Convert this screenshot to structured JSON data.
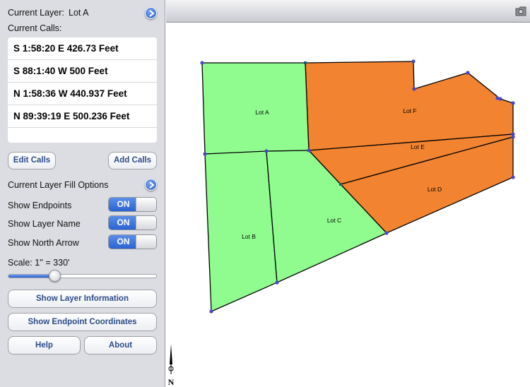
{
  "sidebar": {
    "current_layer_label": "Current Layer:",
    "current_layer_value": "Lot A",
    "current_calls_label": "Current Calls:",
    "calls": [
      "S 1:58:20 E 426.73 Feet",
      "S 88:1:40 W 500 Feet",
      "N 1:58:36 W 440.937 Feet",
      "N 89:39:19 E 500.236 Feet"
    ],
    "edit_calls": "Edit Calls",
    "add_calls": "Add Calls",
    "fill_options_label": "Current Layer Fill Options",
    "toggles": [
      {
        "label": "Show Endpoints",
        "state": "ON"
      },
      {
        "label": "Show Layer Name",
        "state": "ON"
      },
      {
        "label": "Show North Arrow",
        "state": "ON"
      }
    ],
    "scale_label": "Scale: 1'' = 330'",
    "scale_fraction": 0.3,
    "show_layer_info": "Show Layer Information",
    "show_endpoint_coords": "Show Endpoint Coordinates",
    "help": "Help",
    "about": "About"
  },
  "map": {
    "lots": [
      {
        "name": "Lot A",
        "color": "#90fc90"
      },
      {
        "name": "Lot B",
        "color": "#90fc90"
      },
      {
        "name": "Lot C",
        "color": "#90fc90"
      },
      {
        "name": "Lot D",
        "color": "#f28431"
      },
      {
        "name": "Lot E",
        "color": "#f28431"
      },
      {
        "name": "Lot F",
        "color": "#f28431"
      }
    ],
    "north_label": "N"
  }
}
